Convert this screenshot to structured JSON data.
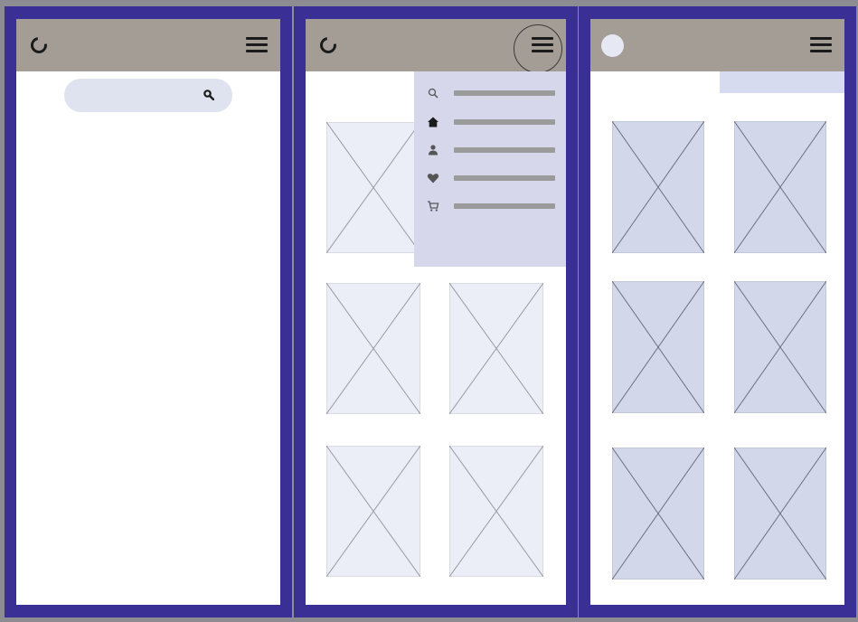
{
  "frames": [
    {
      "header": {
        "logo_icon": "loading-ring-icon",
        "menu_icon": "hamburger-icon"
      },
      "search": {
        "placeholder": "",
        "value": "",
        "icon": "search-icon"
      }
    },
    {
      "header": {
        "logo_icon": "loading-ring-icon",
        "menu_icon": "hamburger-icon",
        "menu_open": true
      },
      "menu": {
        "items": [
          {
            "icon": "search-icon",
            "label": ""
          },
          {
            "icon": "home-icon",
            "label": ""
          },
          {
            "icon": "user-icon",
            "label": ""
          },
          {
            "icon": "heart-icon",
            "label": ""
          },
          {
            "icon": "cart-icon",
            "label": ""
          }
        ]
      },
      "grid": {
        "placeholder_count": 6,
        "icon": "image-placeholder-icon"
      }
    },
    {
      "header": {
        "logo_icon": "avatar-circle",
        "menu_icon": "hamburger-icon"
      },
      "grid": {
        "placeholder_count": 6,
        "icon": "image-placeholder-icon"
      }
    }
  ],
  "colors": {
    "frame": "#3a2f94",
    "header": "#a39d96",
    "menu_panel": "#d7d7ec",
    "search_field": "#dfe2ef",
    "placeholder_light": "#eceef7",
    "placeholder_medium": "#d3d7ea"
  }
}
